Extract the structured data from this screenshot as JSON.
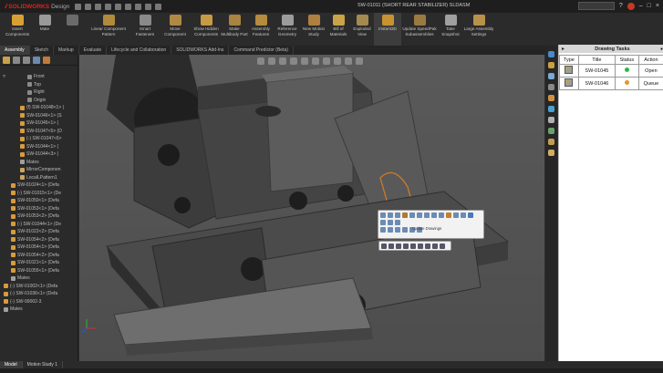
{
  "app": {
    "logo_text": "SOLIDWORKS",
    "logo_suffix": "Design",
    "document_title": "SW-01011 (SHORT REAR STABILIZER) SLDASM",
    "accent_color": "#e02020"
  },
  "ribbon": {
    "buttons": [
      {
        "label": "Insert Components",
        "icon": "insert-components-icon",
        "color": "#d8a034"
      },
      {
        "label": "Mate",
        "icon": "mate-icon",
        "color": "#9a9a9a"
      },
      {
        "label": "",
        "icon": "component-icon",
        "color": "#6b6b6b"
      },
      {
        "label": "Linear Component Pattern",
        "icon": "pattern-icon",
        "color": "#b28a3c"
      },
      {
        "label": "Smart Fasteners",
        "icon": "fastener-icon",
        "color": "#8a8a8a"
      },
      {
        "label": "Move Component",
        "icon": "move-icon",
        "color": "#b08a44"
      },
      {
        "label": "Show Hidden Components",
        "icon": "show-hidden-icon",
        "color": "#c89a44"
      },
      {
        "label": "Make Multibody Part",
        "icon": "multibody-icon",
        "color": "#a88440"
      },
      {
        "label": "Assembly Features",
        "icon": "features-icon",
        "color": "#b58b3e"
      },
      {
        "label": "Reference Geometry",
        "icon": "geometry-icon",
        "color": "#9c9c9c"
      },
      {
        "label": "New Motion Study",
        "icon": "motion-icon",
        "color": "#b08040"
      },
      {
        "label": "Bill of Materials",
        "icon": "bom-icon",
        "color": "#c9a448"
      },
      {
        "label": "Exploded View",
        "icon": "exploded-icon",
        "color": "#a58a50"
      },
      {
        "label": "Instant3D",
        "icon": "instant3d-icon",
        "color": "#c79230"
      },
      {
        "label": "Update SpeedPak Subassemblies",
        "icon": "speedpak-icon",
        "color": "#9a7a40"
      },
      {
        "label": "Take Snapshot",
        "icon": "snapshot-icon",
        "color": "#a0a0a0"
      },
      {
        "label": "Large Assembly Settings",
        "icon": "large-assembly-icon",
        "color": "#b8924a"
      }
    ]
  },
  "tabs": [
    "Assembly",
    "Sketch",
    "Markup",
    "Evaluate",
    "Lifecycle and Collaboration",
    "SOLIDWORKS Add-Ins",
    "Command Predictor (Beta)"
  ],
  "tree": {
    "items": [
      {
        "label": "Front",
        "icon": "plane-icon",
        "kind": "plane",
        "indent": 30
      },
      {
        "label": "Top",
        "icon": "plane-icon",
        "kind": "plane",
        "indent": 30
      },
      {
        "label": "Right",
        "icon": "plane-icon",
        "kind": "plane",
        "indent": 30
      },
      {
        "label": "Origin",
        "icon": "origin-icon",
        "kind": "plane",
        "indent": 30
      },
      {
        "label": "(f) SW-01048<1> (",
        "icon": "part-icon",
        "kind": "part",
        "indent": 22
      },
      {
        "label": "SW-01046<1> (S",
        "icon": "part-icon",
        "kind": "part",
        "indent": 22
      },
      {
        "label": "SW-01045<1> (",
        "icon": "part-icon",
        "kind": "part",
        "indent": 22
      },
      {
        "label": "SW-01047<5> (D",
        "icon": "part-icon",
        "kind": "part",
        "indent": 22
      },
      {
        "label": "(-) SW-01047<6>",
        "icon": "part-icon",
        "kind": "part",
        "indent": 22
      },
      {
        "label": "SW-01044<1> (",
        "icon": "part-icon",
        "kind": "part",
        "indent": 22
      },
      {
        "label": "SW-01044<3> (",
        "icon": "part-icon",
        "kind": "part",
        "indent": 22
      },
      {
        "label": "Mates",
        "icon": "mates-icon",
        "kind": "mates",
        "indent": 22
      },
      {
        "label": "MirrorComponen",
        "icon": "mirror-icon",
        "kind": "folder",
        "indent": 22
      },
      {
        "label": "LocalLPattern1",
        "icon": "pattern-icon",
        "kind": "folder",
        "indent": 22
      },
      {
        "label": "SW-01024<1> (Defa",
        "icon": "part-icon",
        "kind": "part",
        "indent": 12
      },
      {
        "label": "(-) SW-01015<1> (De",
        "icon": "part-icon",
        "kind": "part",
        "indent": 12
      },
      {
        "label": "SW-01050<1> (Defa",
        "icon": "part-icon",
        "kind": "part",
        "indent": 12
      },
      {
        "label": "SW-01053<1> (Defa",
        "icon": "part-icon",
        "kind": "part",
        "indent": 12
      },
      {
        "label": "SW-01053<2> (Defa",
        "icon": "part-icon",
        "kind": "part",
        "indent": 12
      },
      {
        "label": "(-) SW-01044<1> (De",
        "icon": "part-icon",
        "kind": "part",
        "indent": 12
      },
      {
        "label": "SW-01022<2> (Defa",
        "icon": "part-icon",
        "kind": "part",
        "indent": 12
      },
      {
        "label": "SW-01054<2> (Defa",
        "icon": "part-icon",
        "kind": "part",
        "indent": 12
      },
      {
        "label": "SW-01054<1> (Defa",
        "icon": "part-icon",
        "kind": "part",
        "indent": 12
      },
      {
        "label": "SW-01054<2> (Defa",
        "icon": "part-icon",
        "kind": "part",
        "indent": 12
      },
      {
        "label": "SW-01021<1> (Defa",
        "icon": "part-icon",
        "kind": "part",
        "indent": 12
      },
      {
        "label": "SW-01055<1> (Defa",
        "icon": "part-icon",
        "kind": "part",
        "indent": 12
      },
      {
        "label": "Mates",
        "icon": "mates-icon",
        "kind": "mates",
        "indent": 12
      },
      {
        "label": "(-) SW-01002<1> (Defa",
        "icon": "part-icon",
        "kind": "part",
        "indent": 4
      },
      {
        "label": "(-) SW-01036<1> (Defa",
        "icon": "part-icon",
        "kind": "part",
        "indent": 4
      },
      {
        "label": "(-) SW-99002-3",
        "icon": "part-icon",
        "kind": "part",
        "indent": 4
      },
      {
        "label": "Mates",
        "icon": "mates-icon",
        "kind": "mates",
        "indent": 4
      }
    ]
  },
  "context_toolbar": {
    "tooltip": "Update Drawings"
  },
  "panel": {
    "title": "Drawing Tasks",
    "columns": [
      "Type",
      "Title",
      "Status",
      "Action"
    ],
    "rows": [
      {
        "type_icon": "drawing-icon",
        "title": "SW-01045",
        "status_color": "#2db84a",
        "action": "Open"
      },
      {
        "type_icon": "drawing-icon",
        "title": "SW-01046",
        "status_color": "#e8932a",
        "action": "Queue"
      }
    ]
  },
  "bottom_tabs": [
    "Model",
    "Motion Study 1"
  ]
}
